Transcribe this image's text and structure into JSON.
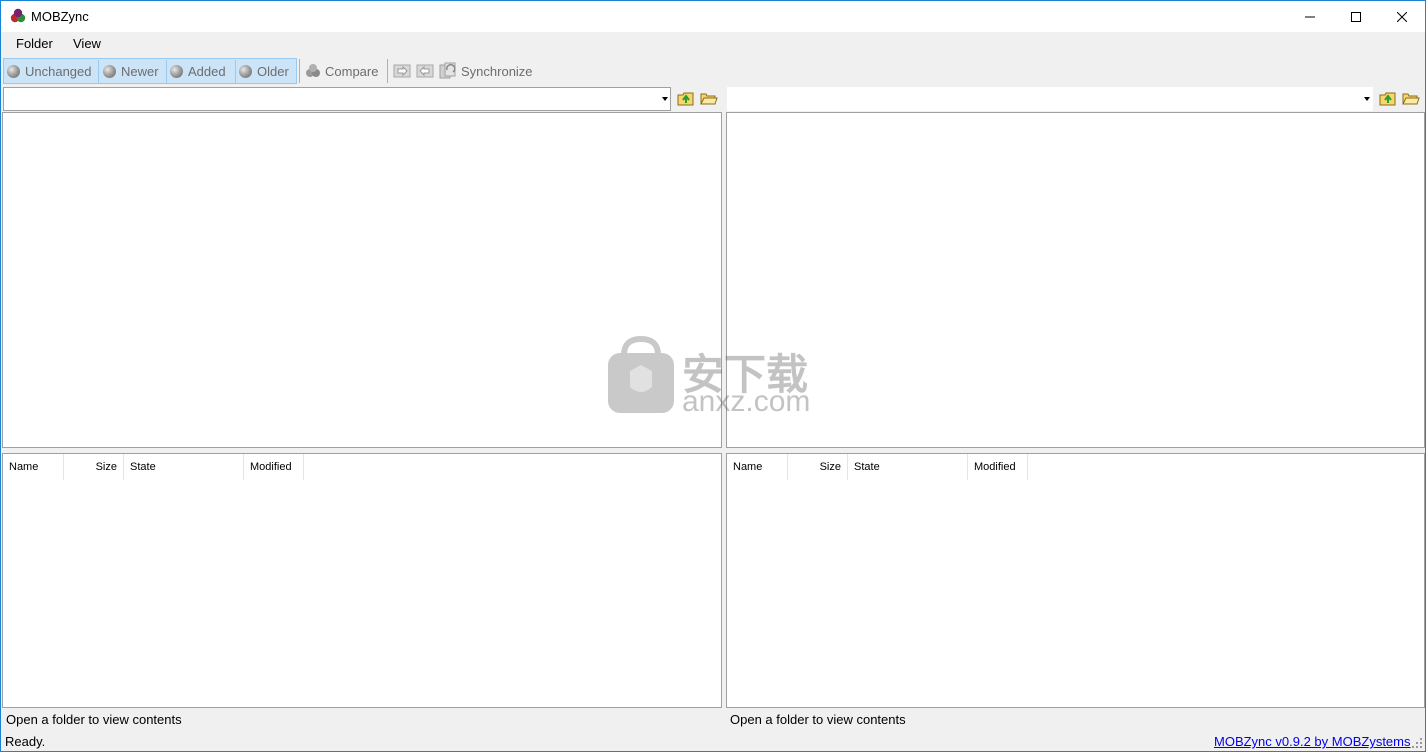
{
  "window": {
    "title": "MOBZync",
    "controls": {
      "minimize": "minimize",
      "maximize": "maximize",
      "close": "close"
    }
  },
  "menu": {
    "folder": "Folder",
    "view": "View"
  },
  "toolbar": {
    "unchanged": "Unchanged",
    "newer": "Newer",
    "added": "Added",
    "older": "Older",
    "compare": "Compare",
    "synchronize": "Synchronize"
  },
  "left": {
    "path_value": "",
    "columns": [
      "Name",
      "Size",
      "State",
      "Modified"
    ],
    "status": "Open a folder to view contents"
  },
  "right": {
    "path_value": "",
    "columns": [
      "Name",
      "Size",
      "State",
      "Modified"
    ],
    "status": "Open a folder to view contents"
  },
  "statusbar": {
    "text": "Ready.",
    "link": "MOBZync v0.9.2 by MOBZystems"
  },
  "watermark": {
    "text_cn": "安下载",
    "text_en": "anxz.com"
  },
  "colors": {
    "accent": "#cce4f7",
    "window_border": "#1883d7",
    "link": "#0000ee"
  }
}
